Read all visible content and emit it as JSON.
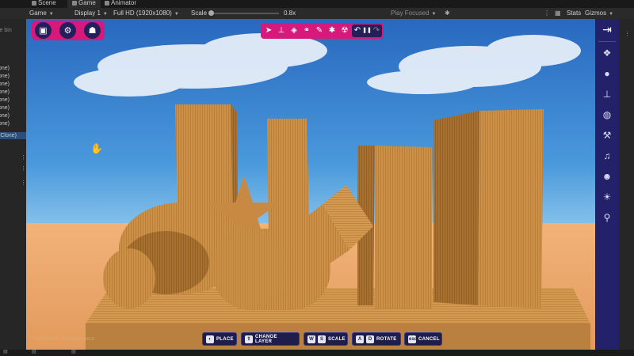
{
  "editor": {
    "tabs": [
      {
        "label": "Scene",
        "icon": "scene-icon"
      },
      {
        "label": "Game",
        "icon": "game-icon",
        "active": true
      },
      {
        "label": "Animator",
        "icon": "animator-icon"
      }
    ],
    "game_toolbar": {
      "view_dropdown": "Game",
      "display_dropdown": "Display 1",
      "resolution_dropdown": "Full HD (1920x1080)",
      "scale_label": "Scale",
      "scale_value": "0.8x",
      "play_mode_dropdown": "Play Focused",
      "stats_label": "Stats",
      "gizmos_label": "Gizmos"
    },
    "hierarchy": {
      "rows": [
        "le bin",
        "one)",
        "one)",
        "one)",
        "one)",
        "one)",
        "one)",
        "one)",
        "one)",
        "(Clone)"
      ]
    }
  },
  "game": {
    "top_left_buttons": [
      {
        "name": "save-button",
        "icon": "floppy-disk-icon"
      },
      {
        "name": "settings-button",
        "icon": "gear-icon"
      },
      {
        "name": "gamepad-button",
        "icon": "gamepad-icon"
      }
    ],
    "tool_toolbar": [
      {
        "name": "select-tool",
        "icon": "cursor-icon",
        "glyph": "➤"
      },
      {
        "name": "stamp-tool",
        "icon": "stamp-icon",
        "glyph": "⊥"
      },
      {
        "name": "cube-tool",
        "icon": "cube-icon",
        "glyph": "◈"
      },
      {
        "name": "link-tool",
        "icon": "link-icon",
        "glyph": "⚭"
      },
      {
        "name": "eyedropper-tool",
        "icon": "eyedropper-icon",
        "glyph": "✎"
      },
      {
        "name": "bug-tool",
        "icon": "bug-icon",
        "glyph": "✱"
      },
      {
        "name": "hazard-tool",
        "icon": "radiation-icon",
        "glyph": "☢"
      }
    ],
    "playback": [
      {
        "name": "undo-button",
        "icon": "undo-icon",
        "glyph": "↶"
      },
      {
        "name": "pause-button",
        "icon": "pause-icon",
        "glyph": "❚❚"
      },
      {
        "name": "redo-button",
        "icon": "redo-icon",
        "glyph": "↷"
      }
    ],
    "sidebar": [
      {
        "name": "collapse-sidebar-button",
        "icon": "arrow-collapse-icon",
        "glyph": "⇥"
      },
      {
        "name": "shapes-category",
        "icon": "shapes-icon",
        "glyph": "❖"
      },
      {
        "name": "fruit-category",
        "icon": "apple-icon",
        "glyph": "●"
      },
      {
        "name": "stamp-category",
        "icon": "stamp-icon",
        "glyph": "⊥"
      },
      {
        "name": "ball-category",
        "icon": "ball-icon",
        "glyph": "◍"
      },
      {
        "name": "tools-category",
        "icon": "hammer-icon",
        "glyph": "⚒"
      },
      {
        "name": "music-category",
        "icon": "music-note-icon",
        "glyph": "♫"
      },
      {
        "name": "creature-category",
        "icon": "monster-icon",
        "glyph": "☻"
      },
      {
        "name": "weather-category",
        "icon": "sun-cloud-icon",
        "glyph": "☀"
      },
      {
        "name": "search-category",
        "icon": "search-icon",
        "glyph": "⚲"
      }
    ],
    "hints": [
      {
        "keys": [
          "◐"
        ],
        "label": "PLACE"
      },
      {
        "keys": [
          "⇧"
        ],
        "label": "CHANGE LAYER"
      },
      {
        "keys": [
          "W",
          "S"
        ],
        "label": "SCALE"
      },
      {
        "keys": [
          "A",
          "D"
        ],
        "label": "ROTATE"
      },
      {
        "keys": [
          "esc"
        ],
        "label": "CANCEL"
      }
    ],
    "watermark": "CARDBOARD · INTERNAL BUILD"
  },
  "colors": {
    "accent_pink": "#d6197a",
    "panel_navy": "#241e5a",
    "sidebar_purple": "#22216a",
    "cardboard": "#c98f45",
    "sky": "#2e78c9",
    "sand": "#e9a86c"
  }
}
